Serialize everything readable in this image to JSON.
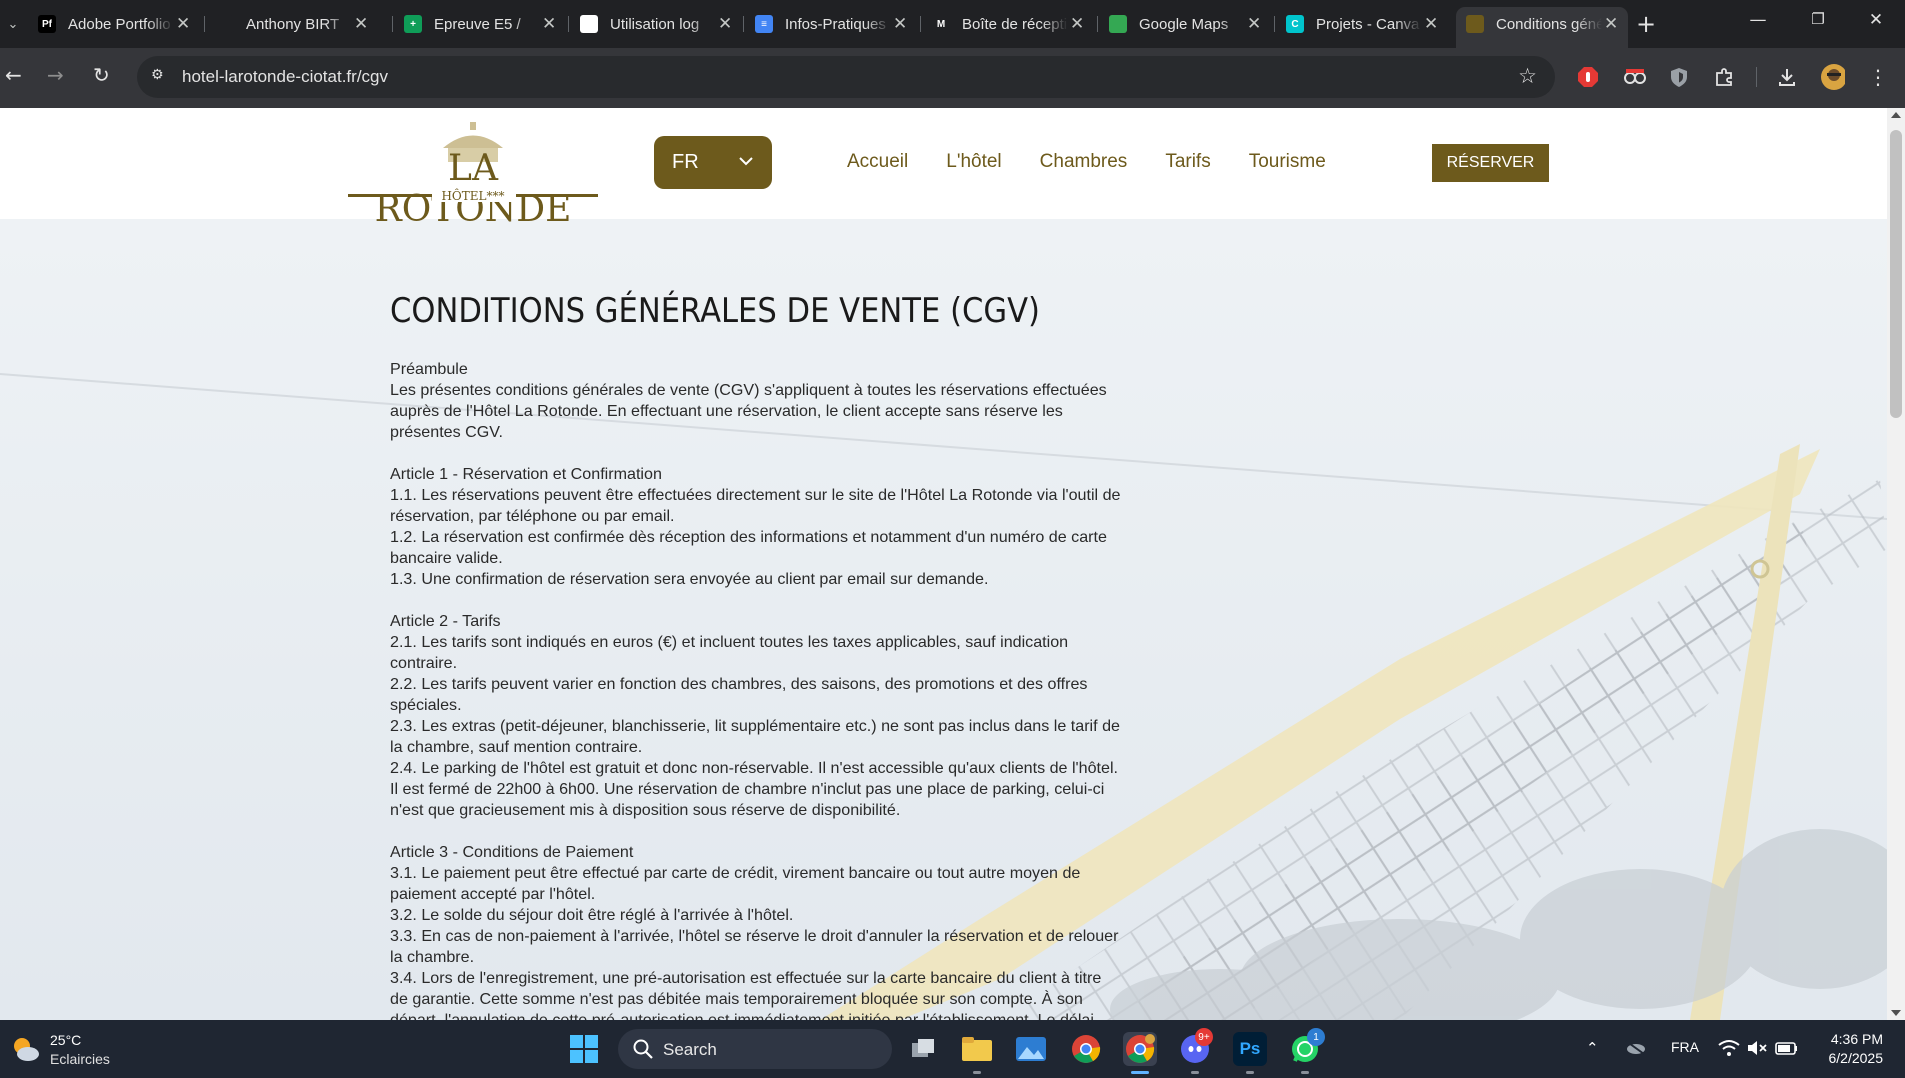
{
  "browser": {
    "tabs": [
      {
        "title": "Adobe Portfolio",
        "favicon_text": "Pf",
        "favicon_color": "#000000"
      },
      {
        "title": "Anthony BIRT",
        "favicon_text": "",
        "favicon_color": "#202124"
      },
      {
        "title": "Epreuve E5 /",
        "favicon_text": "+",
        "favicon_color": "#0f9d58"
      },
      {
        "title": "Utilisation log",
        "favicon_text": "",
        "favicon_color": "#ffffff"
      },
      {
        "title": "Infos-Pratiques",
        "favicon_text": "≡",
        "favicon_color": "#4285f4"
      },
      {
        "title": "Boîte de réception",
        "favicon_text": "M",
        "favicon_color": "#202124"
      },
      {
        "title": "Google Maps",
        "favicon_text": "",
        "favicon_color": "#34a853"
      },
      {
        "title": "Projets - Canva",
        "favicon_text": "C",
        "favicon_color": "#00c4cc"
      },
      {
        "title": "Conditions générales",
        "favicon_text": "",
        "favicon_color": "#6d5a1c"
      }
    ],
    "url": "hotel-larotonde-ciotat.fr/cgv"
  },
  "site": {
    "logo_main": "LA ROTONDE",
    "logo_sub": "HÔTEL",
    "logo_stars": "***",
    "language": "FR",
    "nav": [
      "Accueil",
      "L'hôtel",
      "Chambres",
      "Tarifs",
      "Tourisme"
    ],
    "reserve_label": "RÉSERVER",
    "brand_color": "#6d5a1c"
  },
  "page": {
    "title": "CONDITIONS GÉNÉRALES DE VENTE (CGV)",
    "lines": [
      "Préambule",
      "Les présentes conditions générales de vente (CGV) s'appliquent à toutes les réservations effectuées",
      "auprès de l'Hôtel La Rotonde. En effectuant une réservation, le client accepte sans réserve les",
      "présentes CGV.",
      "",
      "Article 1 - Réservation et Confirmation",
      "1.1. Les réservations peuvent être effectuées directement sur le site de l'Hôtel La Rotonde via l'outil de",
      "réservation, par téléphone ou par email.",
      "1.2. La réservation est confirmée dès réception des informations et notamment d'un numéro de carte",
      "bancaire valide.",
      "1.3. Une confirmation de réservation sera envoyée au client par email sur demande.",
      "",
      "Article 2 - Tarifs",
      "2.1. Les tarifs sont indiqués en euros (€) et incluent toutes les taxes applicables, sauf indication",
      "contraire.",
      "2.2. Les tarifs peuvent varier en fonction des chambres, des saisons, des promotions et des offres",
      "spéciales.",
      "2.3. Les extras (petit-déjeuner, blanchisserie, lit supplémentaire etc.) ne sont pas inclus dans le tarif de",
      "la chambre, sauf mention contraire.",
      "2.4. Le parking de l'hôtel est gratuit et donc non-réservable. Il n'est accessible qu'aux clients de l'hôtel.",
      "Il est fermé de 22h00 à 6h00. Une réservation de chambre n'inclut pas une place de parking, celui-ci",
      "n'est que gracieusement mis à disposition sous réserve de disponibilité.",
      "",
      "Article 3 - Conditions de Paiement",
      "3.1. Le paiement peut être effectué par carte de crédit, virement bancaire ou tout autre moyen de",
      "paiement accepté par l'hôtel.",
      "3.2. Le solde du séjour doit être réglé à l'arrivée à l'hôtel.",
      "3.3. En cas de non-paiement à l'arrivée, l'hôtel se réserve le droit d'annuler la réservation et de relouer",
      "la chambre.",
      "3.4. Lors de l'enregistrement, une pré-autorisation est effectuée sur la carte bancaire du client à titre",
      "de garantie. Cette somme n'est pas débitée mais temporairement bloquée sur son compte. À son",
      "départ, l'annulation de cette pré-autorisation est immédiatement initiée par l'établissement. Le délai"
    ]
  },
  "taskbar": {
    "weather_temp": "25°C",
    "weather_desc": "Eclaircies",
    "search_placeholder": "Search",
    "discord_badge": "9+",
    "whatsapp_badge": "1",
    "language": "FRA",
    "time": "4:36 PM",
    "date": "6/2/2025"
  }
}
